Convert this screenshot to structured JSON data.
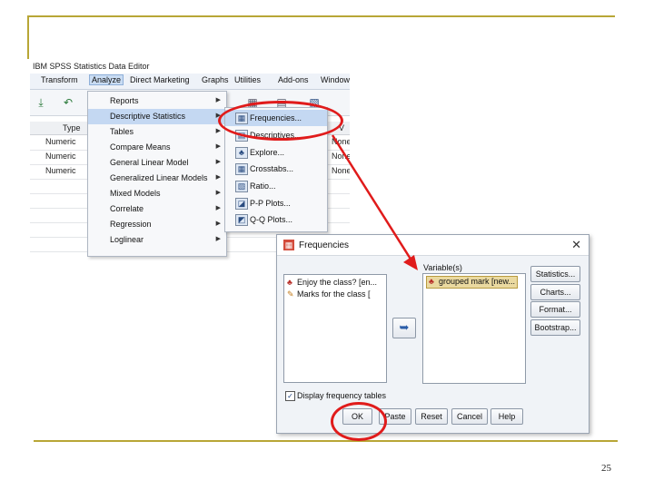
{
  "colors": {
    "accent": "#b8a636",
    "highlight_red": "#e01b1b",
    "menu_highlight": "#c4d8f2"
  },
  "spss": {
    "title": "IBM SPSS Statistics Data Editor",
    "menus": [
      "Transform",
      "Analyze",
      "Direct Marketing",
      "Graphs",
      "Utilities",
      "Add-ons",
      "Window"
    ],
    "column_header": "Type",
    "right_header": "V",
    "rows": [
      {
        "type": "Numeric",
        "right": "None"
      },
      {
        "type": "Numeric",
        "right": "None"
      },
      {
        "type": "Numeric",
        "right": "None"
      }
    ]
  },
  "analyze_menu": [
    {
      "label": "Reports",
      "arrow": "▶"
    },
    {
      "label": "Descriptive Statistics",
      "arrow": "▶"
    },
    {
      "label": "Tables",
      "arrow": "▶"
    },
    {
      "label": "Compare Means",
      "arrow": "▶"
    },
    {
      "label": "General Linear Model",
      "arrow": "▶"
    },
    {
      "label": "Generalized Linear Models",
      "arrow": "▶"
    },
    {
      "label": "Mixed Models",
      "arrow": "▶"
    },
    {
      "label": "Correlate",
      "arrow": "▶"
    },
    {
      "label": "Regression",
      "arrow": "▶"
    },
    {
      "label": "Loglinear",
      "arrow": "▶"
    }
  ],
  "descriptive_submenu": [
    {
      "label": "Frequencies...",
      "icon": "▦"
    },
    {
      "label": "Descriptives...",
      "icon": "▤"
    },
    {
      "label": "Explore...",
      "icon": "♣"
    },
    {
      "label": "Crosstabs...",
      "icon": "▦"
    },
    {
      "label": "Ratio...",
      "icon": "▧"
    },
    {
      "label": "P-P Plots...",
      "icon": "◪"
    },
    {
      "label": "Q-Q Plots...",
      "icon": "◩"
    }
  ],
  "dialog": {
    "title": "Frequencies",
    "close": "✕",
    "source_list": [
      {
        "label": "Enjoy the class? [en...",
        "icon": "♣"
      },
      {
        "label": "Marks for the class [",
        "icon": "✎"
      }
    ],
    "variables_label": "Variable(s)",
    "variables": [
      {
        "label": "grouped mark [new...",
        "icon": "♣"
      }
    ],
    "move_arrow": "➥",
    "side_buttons": [
      "Statistics...",
      "Charts...",
      "Format...",
      "Bootstrap..."
    ],
    "checkbox_label": "Display frequency tables",
    "checkbox_mark": "✓",
    "bottom_buttons": [
      "OK",
      "Paste",
      "Reset",
      "Cancel",
      "Help"
    ]
  },
  "page_number": "25"
}
